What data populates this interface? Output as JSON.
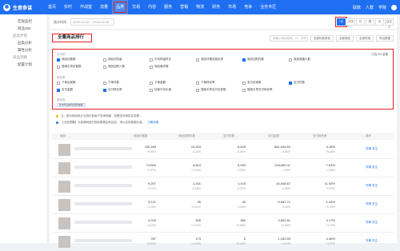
{
  "header": {
    "logo": "生意参谋",
    "nav": [
      {
        "label": "首页"
      },
      {
        "label": "实时"
      },
      {
        "label": "作战室"
      },
      {
        "label": "流量"
      },
      {
        "label": "品类",
        "active": true
      },
      {
        "label": "交易"
      },
      {
        "label": "内容"
      },
      {
        "label": "服务"
      },
      {
        "label": "营销"
      },
      {
        "label": "物流"
      },
      {
        "label": "财务"
      },
      {
        "label": "市场"
      },
      {
        "label": "竞争"
      },
      {
        "label": "业务专区"
      }
    ],
    "right": [
      "取数",
      "人群",
      "学院"
    ]
  },
  "sidebar": {
    "items": [
      {
        "label": "宏观监控",
        "type": "item"
      },
      {
        "label": "商品360",
        "type": "item"
      },
      {
        "label": "品类罗盘",
        "type": "group"
      },
      {
        "label": "品类分析",
        "type": "item"
      },
      {
        "label": "属性分析",
        "type": "item"
      },
      {
        "label": "商品洞察",
        "type": "group"
      },
      {
        "label": "配置计划",
        "type": "item"
      }
    ]
  },
  "subbar": {
    "date_label": "统计时间",
    "date_value": "2020-02-02 ~ 2020-02-08",
    "periods": [
      "7天",
      "30天",
      "日",
      "周",
      "月",
      "自定义"
    ],
    "active_period": "7天"
  },
  "section": {
    "title": "全量商品排行",
    "search_placeholder": "请输入商品名称、ID、货号",
    "tools": [
      "全部标准类目",
      "全部商品",
      "全部终端",
      "导出数据"
    ]
  },
  "metrics": {
    "chosen": "已选 5/5 重置",
    "groups": [
      {
        "label": "访问类",
        "items": [
          {
            "label": "商品访客数",
            "on": true
          },
          {
            "label": "商品浏览量",
            "on": false
          },
          {
            "label": "平均停留时长",
            "on": false
          },
          {
            "label": "商品详情页跳出率",
            "on": false
          },
          {
            "label": "商品加购件数",
            "on": true
          },
          {
            "label": "商品收藏人数",
            "on": false
          },
          {
            "label": "搜索引导访客数",
            "on": false
          },
          {
            "label": "商品加购人数",
            "on": false
          },
          {
            "label": "商品微详情",
            "on": false
          }
        ]
      },
      {
        "label": "转化类",
        "items": [
          {
            "label": "下单买家数",
            "on": false
          },
          {
            "label": "下单件数",
            "on": false
          },
          {
            "label": "下单金额",
            "on": false
          },
          {
            "label": "下单转化率",
            "on": false
          },
          {
            "label": "支付买家数",
            "on": false
          },
          {
            "label": "支付件数",
            "on": true
          },
          {
            "label": "支付金额",
            "on": true
          },
          {
            "label": "支付转化率",
            "on": true
          },
          {
            "label": "访客平均价值",
            "on": false
          },
          {
            "label": "搜索引导支付买家数",
            "on": false
          },
          {
            "label": "搜索引导支付转化率",
            "on": false
          }
        ]
      },
      {
        "label": "服务类",
        "items": []
      }
    ],
    "tag": "售中售后成功退款金额"
  },
  "notes": [
    {
      "text": "注：部分指标统计支持付费用户查询明细，如需查询请前往查看。",
      "link": ""
    },
    {
      "text": "【大促提醒】大促期间部分指标数据会有延迟，请以实际数据为准。",
      "link": "了解详情"
    }
  ],
  "table": {
    "headers": [
      "商品",
      "商品访客数",
      "商品加购件数",
      "支付件数",
      "支付金额",
      "支付转化率",
      "操作"
    ],
    "rows": [
      {
        "c": [
          [
            "150,469",
            "+5.50%"
          ],
          [
            "10,003",
            "-0.22%"
          ],
          [
            "6,529",
            "-0.69%"
          ],
          [
            "661,044.64",
            "-0.50%"
          ],
          [
            "4.18%",
            "+6.06%"
          ]
        ]
      },
      {
        "c": [
          [
            "74,500",
            "-0.07%"
          ],
          [
            "6,824",
            "+1.93%"
          ],
          [
            "6,093",
            "-4.35%"
          ],
          [
            "244,680.11",
            "-1.94%"
          ],
          [
            "7.04%",
            "-2.98%"
          ]
        ]
      },
      {
        "c": [
          [
            "9,207",
            "-0.12%"
          ],
          [
            "1,161",
            "-0.53%"
          ],
          [
            "1,103",
            "-0.27%"
          ],
          [
            "43,045.67",
            "-0.06%"
          ],
          [
            "11.92%",
            "+0.92%"
          ]
        ]
      },
      {
        "c": [
          [
            "3,121",
            "-0.15%"
          ],
          [
            "35",
            "+0.61%"
          ],
          [
            "45",
            "-3.25%"
          ],
          [
            "5,587.71",
            "-3.44%"
          ],
          [
            "1.44%",
            "+0.35%"
          ]
        ]
      },
      {
        "c": [
          [
            "2,076",
            "-0.22%"
          ],
          [
            "305",
            "+4.01%"
          ],
          [
            "360",
            "+3.96%"
          ],
          [
            "3,502.61",
            "+4.56%"
          ],
          [
            "4.17%",
            "+1.79%"
          ]
        ]
      },
      {
        "c": [
          [
            "787",
            "+2.52%"
          ],
          [
            "173",
            "+4.41%"
          ],
          [
            "8",
            "+0.04%"
          ],
          [
            "1,152.55",
            "+1.91%"
          ],
          [
            "3.46%",
            "+4.57%"
          ]
        ]
      }
    ],
    "ops": [
      "详情",
      "关注"
    ]
  }
}
